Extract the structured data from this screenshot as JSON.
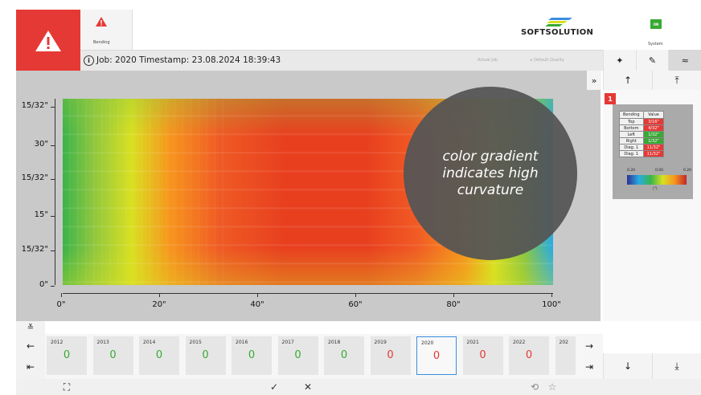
{
  "header": {
    "bending_label": "Bending",
    "logo_text": "SOFTSOLUTION",
    "system_label": "System",
    "system_led": "ON"
  },
  "job_bar": {
    "title": "Job: 2020 Timestamp: 23.08.2024 18:39:43",
    "dropdown_1": "Actual Job",
    "dropdown_2": "▸ Default Quality"
  },
  "chart_data": {
    "type": "heatmap",
    "title": "",
    "xlabel": "",
    "ylabel": "",
    "x_ticks": [
      "0\"",
      "20\"",
      "40\"",
      "60\"",
      "80\"",
      "100\""
    ],
    "y_ticks": [
      "15/32\"",
      "30\"",
      "15/32\"",
      "15\"",
      "15/32\"",
      "0\""
    ],
    "xlim": [
      0,
      100
    ],
    "colormap": [
      "#2e3192",
      "#29abe2",
      "#39b54a",
      "#d9e021",
      "#f7941d",
      "#c1272d"
    ],
    "grid": false
  },
  "callout": {
    "text": "color gradient indicates high curvature"
  },
  "right_panel": {
    "expand": "»",
    "badge": "1",
    "table_headers": [
      "Bending",
      "Value"
    ],
    "rows": [
      {
        "key": "Top",
        "value": "3/16\"",
        "color": "#e53935"
      },
      {
        "key": "Bottom",
        "value": "4/32\"",
        "color": "#e53935"
      },
      {
        "key": "Left",
        "value": "1/32\"",
        "color": "#39a935"
      },
      {
        "key": "Right",
        "value": "1/32\"",
        "color": "#39a935"
      },
      {
        "key": "Diag. 1",
        "value": "11/32\"",
        "color": "#e53935"
      },
      {
        "key": "Diag. 1",
        "value": "11/32\"",
        "color": "#e53935"
      }
    ],
    "colorbar_ticks": [
      "0.20",
      "0.00",
      "0.20"
    ],
    "colorbar_unit": "(\")"
  },
  "jobs": [
    {
      "year": "2012",
      "count": "0",
      "color": "#39a935"
    },
    {
      "year": "2013",
      "count": "0",
      "color": "#39a935"
    },
    {
      "year": "2014",
      "count": "0",
      "color": "#39a935"
    },
    {
      "year": "2015",
      "count": "0",
      "color": "#39a935"
    },
    {
      "year": "2016",
      "count": "0",
      "color": "#39a935"
    },
    {
      "year": "2017",
      "count": "0",
      "color": "#39a935"
    },
    {
      "year": "2018",
      "count": "0",
      "color": "#39a935"
    },
    {
      "year": "2019",
      "count": "0",
      "color": "#e53935"
    },
    {
      "year": "2020",
      "count": "0",
      "color": "#e53935",
      "selected": true
    },
    {
      "year": "2021",
      "count": "0",
      "color": "#e53935"
    },
    {
      "year": "2022",
      "count": "0",
      "color": "#e53935"
    },
    {
      "year": "202",
      "count": "",
      "color": "#e53935"
    }
  ],
  "icons": {
    "collapse": "≚",
    "prev": "←",
    "first": "⇤",
    "next": "→",
    "last": "⇥",
    "up": "↑",
    "top": "⤒",
    "down": "↓",
    "bottom": "⤓",
    "fullscreen": "⛶",
    "confirm": "✓",
    "cancel": "✕",
    "reset": "⟲",
    "favorite": "☆",
    "sparkle": "✦",
    "pencil": "✎",
    "wave": "≈"
  }
}
